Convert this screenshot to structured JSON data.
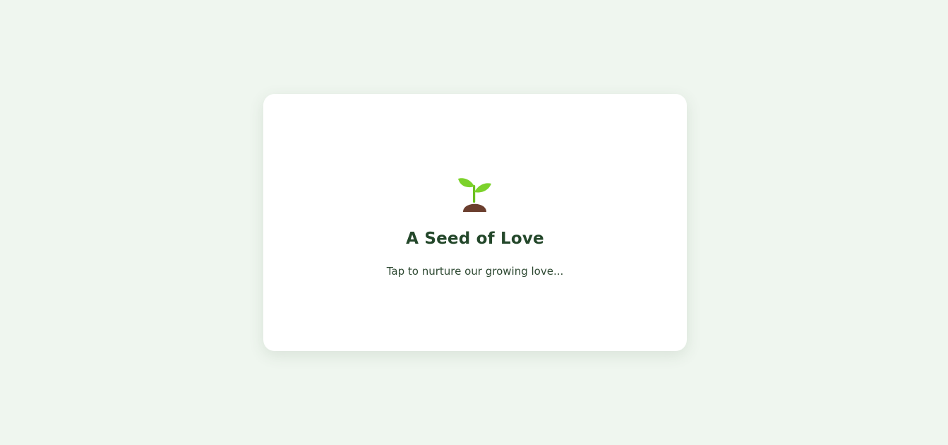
{
  "card": {
    "title": "A Seed of Love",
    "subtitle": "Tap to nurture our growing love..."
  },
  "icon": {
    "name": "seedling-icon",
    "leaf_color": "#7cd22b",
    "stem_color": "#6cc020",
    "soil_color": "#6b3e2e"
  },
  "colors": {
    "background": "#eff6ef",
    "card": "#ffffff",
    "text": "#23472a"
  }
}
